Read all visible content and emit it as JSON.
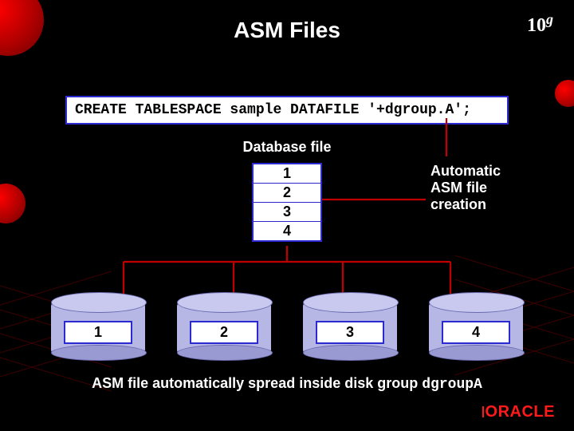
{
  "title": "ASM Files",
  "logo": {
    "num": "10",
    "sup": "g"
  },
  "sql": "CREATE TABLESPACE sample DATAFILE '+dgroup.A';",
  "database_file_label": "Database file",
  "stack": [
    "1",
    "2",
    "3",
    "4"
  ],
  "auto_text": {
    "l1": "Automatic",
    "l2": "ASM file",
    "l3": "creation"
  },
  "disk_labels": [
    "1",
    "2",
    "3",
    "4"
  ],
  "bottom_text": "ASM file automatically spread inside disk group ",
  "bottom_code": "dgroupA",
  "oracle": "ORACLE"
}
